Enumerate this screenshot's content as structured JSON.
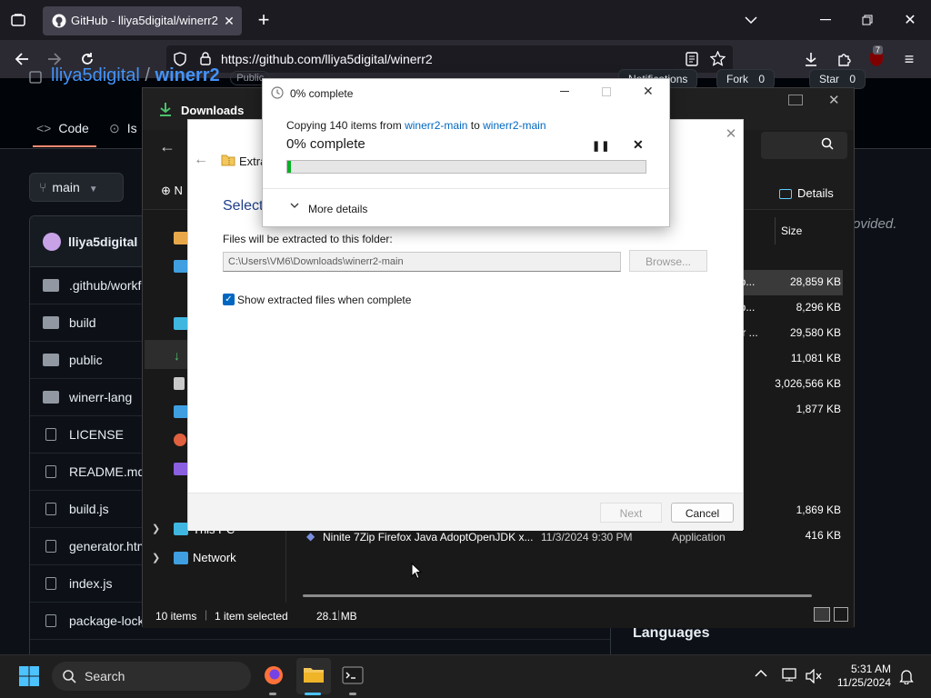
{
  "browser": {
    "tab_title": "GitHub - lliya5digital/winerr2",
    "url": "https://github.com/lliya5digital/winerr2",
    "extensions_badge": "7"
  },
  "github": {
    "owner": "lliya5digital",
    "repo": "winerr2",
    "visibility": "Public",
    "notifications_label": "Notifications",
    "fork_label": "Fork",
    "fork_count": "0",
    "star_label": "Star",
    "star_count": "0",
    "tab_code": "Code",
    "tab_issues": "Is",
    "branch": "main",
    "commit_author": "lliya5digital",
    "files": [
      {
        "name": ".github/workfl",
        "type": "folder"
      },
      {
        "name": "build",
        "type": "folder"
      },
      {
        "name": "public",
        "type": "folder"
      },
      {
        "name": "winerr-lang",
        "type": "folder"
      },
      {
        "name": "LICENSE",
        "type": "file"
      },
      {
        "name": "README.md",
        "type": "file"
      },
      {
        "name": "build.js",
        "type": "file"
      },
      {
        "name": "generator.htm",
        "type": "file"
      },
      {
        "name": "index.js",
        "type": "file"
      },
      {
        "name": "package-lock",
        "type": "file"
      }
    ],
    "about_tail": "ovided.",
    "languages_heading": "Languages"
  },
  "explorer": {
    "title": "Downloads",
    "details_label": "Details",
    "size_header": "Size",
    "sizes": [
      "28,859 KB",
      "8,296 KB",
      "29,580 KB",
      "11,081 KB",
      "3,026,566 KB",
      "1,877 KB",
      "1,869 KB",
      "416 KB"
    ],
    "truncated_types": [
      "pp...",
      "pp...",
      "ler ..."
    ],
    "nav_new": "N",
    "nav_this_pc": "This PC",
    "nav_network": "Network",
    "ninite_name": "Ninite 7Zip Firefox Java AdoptOpenJDK x...",
    "ninite_date": "11/3/2024 9:30 PM",
    "ninite_type": "Application",
    "status_items": "10 items",
    "status_selected": "1 item selected",
    "status_size": "28.1 MB"
  },
  "wizard": {
    "title": "Extra",
    "heading": "Select",
    "path_label": "Files will be extracted to this folder:",
    "path_value": "C:\\Users\\VM6\\Downloads\\winerr2-main",
    "browse_label": "Browse...",
    "show_files_label": "Show extracted files when complete",
    "show_files_checked": true,
    "next_label": "Next",
    "cancel_label": "Cancel"
  },
  "progress": {
    "title": "0% complete",
    "copying_prefix": "Copying 140 items from",
    "source": "winerr2-main",
    "to_word": "to",
    "destination": "winerr2-main",
    "percent_label": "0% complete",
    "percent_value": 0.01,
    "more_details": "More details"
  },
  "taskbar": {
    "search_label": "Search",
    "time": "5:31 AM",
    "date": "11/25/2024"
  },
  "colors": {
    "github_link": "#4493f8",
    "progress_green": "#06b025",
    "windows_accent": "#0067c0"
  }
}
